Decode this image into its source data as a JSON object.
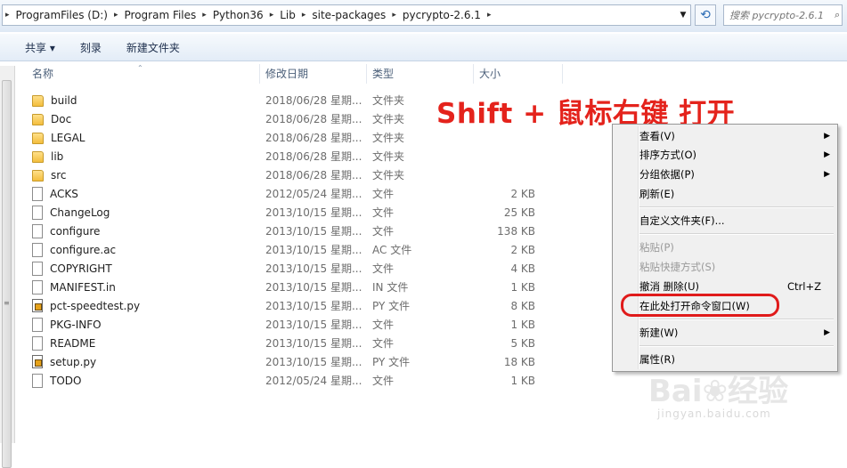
{
  "address": {
    "breadcrumbs": [
      "ProgramFiles (D:)",
      "Program Files",
      "Python36",
      "Lib",
      "site-packages",
      "pycrypto-2.6.1"
    ]
  },
  "search": {
    "placeholder": "搜索 pycrypto-2.6.1"
  },
  "toolbar": {
    "share": "共享 ▾",
    "burn": "刻录",
    "new_folder": "新建文件夹"
  },
  "columns": {
    "name": "名称",
    "date": "修改日期",
    "type": "类型",
    "size": "大小"
  },
  "files": [
    {
      "name": "build",
      "date": "2018/06/28 星期...",
      "type": "文件夹",
      "size": "",
      "icon": "folder-icon"
    },
    {
      "name": "Doc",
      "date": "2018/06/28 星期...",
      "type": "文件夹",
      "size": "",
      "icon": "folder-icon"
    },
    {
      "name": "LEGAL",
      "date": "2018/06/28 星期...",
      "type": "文件夹",
      "size": "",
      "icon": "folder-icon"
    },
    {
      "name": "lib",
      "date": "2018/06/28 星期...",
      "type": "文件夹",
      "size": "",
      "icon": "folder-icon"
    },
    {
      "name": "src",
      "date": "2018/06/28 星期...",
      "type": "文件夹",
      "size": "",
      "icon": "folder-icon"
    },
    {
      "name": "ACKS",
      "date": "2012/05/24 星期...",
      "type": "文件",
      "size": "2 KB",
      "icon": "file-icon"
    },
    {
      "name": "ChangeLog",
      "date": "2013/10/15 星期...",
      "type": "文件",
      "size": "25 KB",
      "icon": "file-icon"
    },
    {
      "name": "configure",
      "date": "2013/10/15 星期...",
      "type": "文件",
      "size": "138 KB",
      "icon": "file-icon"
    },
    {
      "name": "configure.ac",
      "date": "2013/10/15 星期...",
      "type": "AC 文件",
      "size": "2 KB",
      "icon": "file-icon"
    },
    {
      "name": "COPYRIGHT",
      "date": "2013/10/15 星期...",
      "type": "文件",
      "size": "4 KB",
      "icon": "file-icon"
    },
    {
      "name": "MANIFEST.in",
      "date": "2013/10/15 星期...",
      "type": "IN 文件",
      "size": "1 KB",
      "icon": "file-icon"
    },
    {
      "name": "pct-speedtest.py",
      "date": "2013/10/15 星期...",
      "type": "PY 文件",
      "size": "8 KB",
      "icon": "python-file-icon"
    },
    {
      "name": "PKG-INFO",
      "date": "2013/10/15 星期...",
      "type": "文件",
      "size": "1 KB",
      "icon": "file-icon"
    },
    {
      "name": "README",
      "date": "2013/10/15 星期...",
      "type": "文件",
      "size": "5 KB",
      "icon": "file-icon"
    },
    {
      "name": "setup.py",
      "date": "2013/10/15 星期...",
      "type": "PY 文件",
      "size": "18 KB",
      "icon": "python-file-icon"
    },
    {
      "name": "TODO",
      "date": "2012/05/24 星期...",
      "type": "文件",
      "size": "1 KB",
      "icon": "file-icon"
    }
  ],
  "annotation": "Shift + 鼠标右键 打开",
  "context_menu": {
    "view": "查看(V)",
    "sort_by": "排序方式(O)",
    "group_by": "分组依据(P)",
    "refresh": "刷新(E)",
    "customize": "自定义文件夹(F)...",
    "paste": "粘贴(P)",
    "paste_shortcut": "粘贴快捷方式(S)",
    "undo_delete": "撤消 删除(U)",
    "undo_shortcut": "Ctrl+Z",
    "open_cmd": "在此处打开命令窗口(W)",
    "new": "新建(W)",
    "properties": "属性(R)"
  },
  "watermark": {
    "logo": "Baidu经验",
    "url": "jingyan.baidu.com"
  },
  "colors": {
    "annotation": "#e4231c",
    "highlight_ring": "#e01b1b"
  }
}
